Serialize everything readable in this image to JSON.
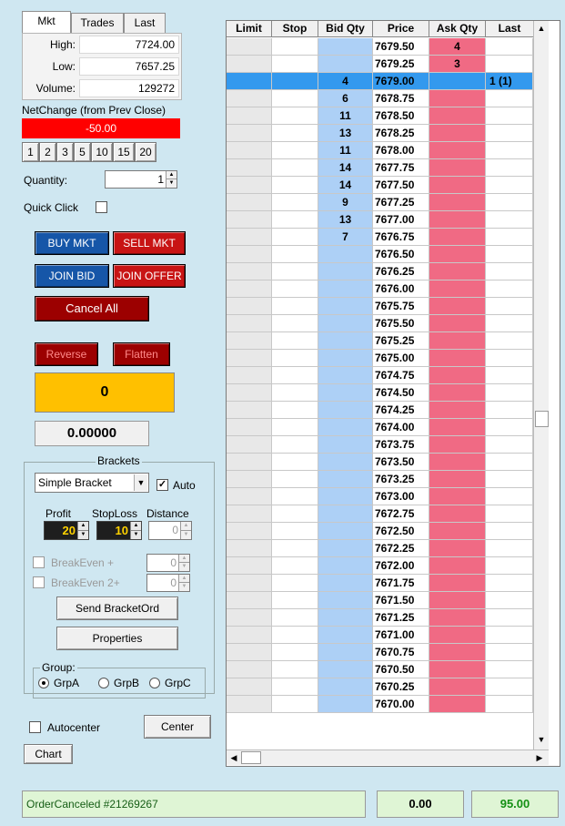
{
  "tabs": [
    "Mkt",
    "Trades",
    "Last"
  ],
  "stats": {
    "high_label": "High:",
    "high": "7724.00",
    "low_label": "Low:",
    "low": "7657.25",
    "volume_label": "Volume:",
    "volume": "129272"
  },
  "net_change": {
    "label": "NetChange (from Prev Close)",
    "value": "-50.00"
  },
  "quick_qty_buttons": [
    "1",
    "2",
    "3",
    "5",
    "10",
    "15",
    "20"
  ],
  "quantity": {
    "label": "Quantity:",
    "value": "1"
  },
  "quick_click": {
    "label": "Quick Click",
    "checked": false
  },
  "buttons": {
    "buy_mkt": "BUY MKT",
    "sell_mkt": "SELL MKT",
    "join_bid": "JOIN BID",
    "join_offer": "JOIN OFFER",
    "cancel_all": "Cancel All",
    "reverse": "Reverse",
    "flatten": "Flatten"
  },
  "position": "0",
  "pnl": "0.00000",
  "brackets": {
    "title": "Brackets",
    "type": "Simple Bracket",
    "auto_label": "Auto",
    "auto_checked": true,
    "profit_label": "Profit",
    "profit": "20",
    "stoploss_label": "StopLoss",
    "stoploss": "10",
    "distance_label": "Distance",
    "distance": "0",
    "breakeven1_label": "BreakEven +",
    "breakeven1": "0",
    "breakeven2_label": "BreakEven 2+",
    "breakeven2": "0",
    "send_label": "Send BracketOrd",
    "properties_label": "Properties"
  },
  "group": {
    "title": "Group:",
    "options": [
      "GrpA",
      "GrpB",
      "GrpC"
    ],
    "selected": "GrpA"
  },
  "autocenter": {
    "label": "Autocenter",
    "checked": false
  },
  "center_label": "Center",
  "chart_label": "Chart",
  "ladder": {
    "headers": [
      "Limit",
      "Stop",
      "Bid Qty",
      "Price",
      "Ask Qty",
      "Last"
    ],
    "selected_price": "7679.00",
    "rows": [
      {
        "price": "7679.50",
        "bid": "",
        "ask": "4",
        "last": ""
      },
      {
        "price": "7679.25",
        "bid": "",
        "ask": "3",
        "last": ""
      },
      {
        "price": "7679.00",
        "bid": "4",
        "ask": "",
        "last": "1 (1)"
      },
      {
        "price": "7678.75",
        "bid": "6",
        "ask": "",
        "last": ""
      },
      {
        "price": "7678.50",
        "bid": "11",
        "ask": "",
        "last": ""
      },
      {
        "price": "7678.25",
        "bid": "13",
        "ask": "",
        "last": ""
      },
      {
        "price": "7678.00",
        "bid": "11",
        "ask": "",
        "last": ""
      },
      {
        "price": "7677.75",
        "bid": "14",
        "ask": "",
        "last": ""
      },
      {
        "price": "7677.50",
        "bid": "14",
        "ask": "",
        "last": ""
      },
      {
        "price": "7677.25",
        "bid": "9",
        "ask": "",
        "last": ""
      },
      {
        "price": "7677.00",
        "bid": "13",
        "ask": "",
        "last": ""
      },
      {
        "price": "7676.75",
        "bid": "7",
        "ask": "",
        "last": ""
      },
      {
        "price": "7676.50",
        "bid": "",
        "ask": "",
        "last": ""
      },
      {
        "price": "7676.25",
        "bid": "",
        "ask": "",
        "last": ""
      },
      {
        "price": "7676.00",
        "bid": "",
        "ask": "",
        "last": ""
      },
      {
        "price": "7675.75",
        "bid": "",
        "ask": "",
        "last": ""
      },
      {
        "price": "7675.50",
        "bid": "",
        "ask": "",
        "last": ""
      },
      {
        "price": "7675.25",
        "bid": "",
        "ask": "",
        "last": ""
      },
      {
        "price": "7675.00",
        "bid": "",
        "ask": "",
        "last": ""
      },
      {
        "price": "7674.75",
        "bid": "",
        "ask": "",
        "last": ""
      },
      {
        "price": "7674.50",
        "bid": "",
        "ask": "",
        "last": ""
      },
      {
        "price": "7674.25",
        "bid": "",
        "ask": "",
        "last": ""
      },
      {
        "price": "7674.00",
        "bid": "",
        "ask": "",
        "last": ""
      },
      {
        "price": "7673.75",
        "bid": "",
        "ask": "",
        "last": ""
      },
      {
        "price": "7673.50",
        "bid": "",
        "ask": "",
        "last": ""
      },
      {
        "price": "7673.25",
        "bid": "",
        "ask": "",
        "last": ""
      },
      {
        "price": "7673.00",
        "bid": "",
        "ask": "",
        "last": ""
      },
      {
        "price": "7672.75",
        "bid": "",
        "ask": "",
        "last": ""
      },
      {
        "price": "7672.50",
        "bid": "",
        "ask": "",
        "last": ""
      },
      {
        "price": "7672.25",
        "bid": "",
        "ask": "",
        "last": ""
      },
      {
        "price": "7672.00",
        "bid": "",
        "ask": "",
        "last": ""
      },
      {
        "price": "7671.75",
        "bid": "",
        "ask": "",
        "last": ""
      },
      {
        "price": "7671.50",
        "bid": "",
        "ask": "",
        "last": ""
      },
      {
        "price": "7671.25",
        "bid": "",
        "ask": "",
        "last": ""
      },
      {
        "price": "7671.00",
        "bid": "",
        "ask": "",
        "last": ""
      },
      {
        "price": "7670.75",
        "bid": "",
        "ask": "",
        "last": ""
      },
      {
        "price": "7670.50",
        "bid": "",
        "ask": "",
        "last": ""
      },
      {
        "price": "7670.25",
        "bid": "",
        "ask": "",
        "last": ""
      },
      {
        "price": "7670.00",
        "bid": "",
        "ask": "",
        "last": ""
      }
    ]
  },
  "status": {
    "message": "OrderCanceled #21269267",
    "value1": "0.00",
    "value2": "95.00"
  },
  "colors": {
    "background": "#cfe7f1",
    "bid": "#add0f6",
    "ask": "#f06a84",
    "selected_row": "#3399ee",
    "net_change_bg": "#ff0000",
    "position_bg": "#ffc000",
    "status_green": "#149014"
  },
  "icons": {
    "scroll_up": "up-arrow-icon",
    "scroll_down": "down-arrow-icon",
    "scroll_left": "left-arrow-icon",
    "scroll_right": "right-arrow-icon",
    "spinner": "spinner-arrows-icon",
    "dropdown": "chevron-down-icon"
  }
}
